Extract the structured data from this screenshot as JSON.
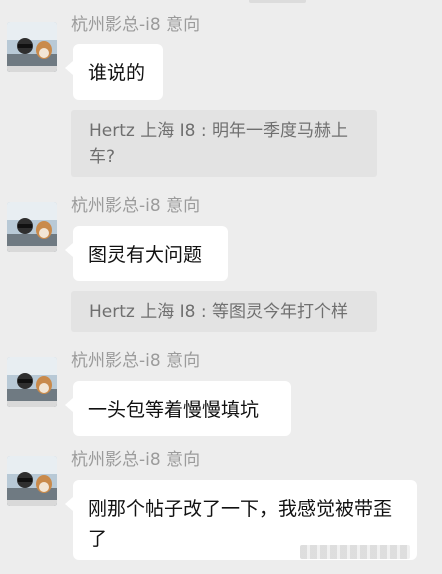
{
  "messages": [
    {
      "sender": "杭州影总-i8 意向",
      "text": "谁说的",
      "quote": "Hertz 上海 I8 : 明年一季度马赫上车?"
    },
    {
      "sender": "杭州影总-i8 意向",
      "text": "图灵有大问题",
      "quote": "Hertz 上海 I8 : 等图灵今年打个样"
    },
    {
      "sender": "杭州影总-i8 意向",
      "text": "一头包等着慢慢填坑"
    },
    {
      "sender": "杭州影总-i8 意向",
      "text": "刚那个帖子改了一下，我感觉被带歪了"
    }
  ],
  "colors": {
    "background": "#ededed",
    "bubble": "#ffffff",
    "quote_bg": "#e3e3e3",
    "sender_text": "#9b9b9b"
  }
}
